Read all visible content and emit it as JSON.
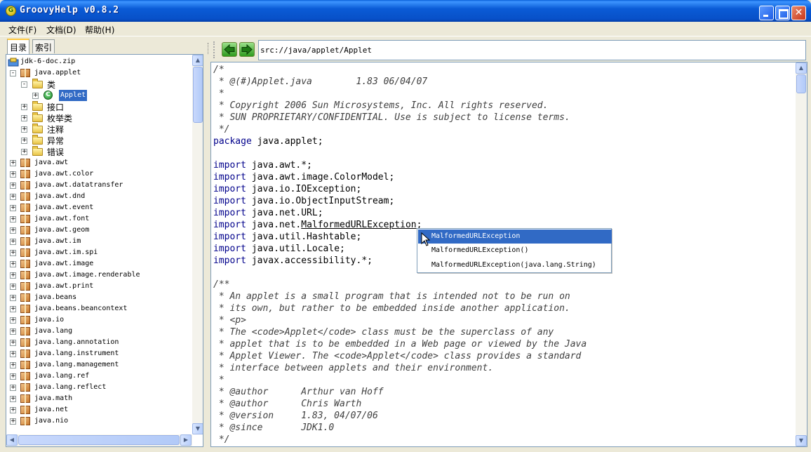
{
  "window": {
    "title": "GroovyHelp v0.8.2",
    "app_icon_glyph": "G",
    "minimize_glyph": "",
    "maximize_glyph": "",
    "close_glyph": "✕"
  },
  "menu": [
    {
      "label": "文件(F)"
    },
    {
      "label": "文档(D)"
    },
    {
      "label": "帮助(H)"
    }
  ],
  "left_tabs": [
    {
      "label": "目录",
      "active": true
    },
    {
      "label": "索引",
      "active": false
    }
  ],
  "tree": {
    "root": "jdk-6-doc.zip",
    "expanded_package": "java.applet",
    "categories": [
      {
        "label": "类",
        "expanded": true
      },
      {
        "label": "接口"
      },
      {
        "label": "枚举类"
      },
      {
        "label": "注释"
      },
      {
        "label": "异常"
      },
      {
        "label": "错误"
      }
    ],
    "selected_class": "Applet",
    "class_icon_glyph": "C",
    "packages": [
      "java.awt",
      "java.awt.color",
      "java.awt.datatransfer",
      "java.awt.dnd",
      "java.awt.event",
      "java.awt.font",
      "java.awt.geom",
      "java.awt.im",
      "java.awt.im.spi",
      "java.awt.image",
      "java.awt.image.renderable",
      "java.awt.print",
      "java.beans",
      "java.beans.beancontext",
      "java.io",
      "java.lang",
      "java.lang.annotation",
      "java.lang.instrument",
      "java.lang.management",
      "java.lang.ref",
      "java.lang.reflect",
      "java.math",
      "java.net",
      "java.nio"
    ]
  },
  "toolbar": {
    "back_icon": "back-arrow-icon",
    "forward_icon": "forward-arrow-icon",
    "address": "src://java/applet/Applet"
  },
  "code_lines": [
    {
      "type": "comment",
      "text": "/*"
    },
    {
      "type": "comment",
      "text": " * @(#)Applet.java        1.83 06/04/07"
    },
    {
      "type": "comment",
      "text": " *"
    },
    {
      "type": "comment",
      "text": " * Copyright 2006 Sun Microsystems, Inc. All rights reserved."
    },
    {
      "type": "comment",
      "text": " * SUN PROPRIETARY/CONFIDENTIAL. Use is subject to license terms."
    },
    {
      "type": "comment",
      "text": " */"
    },
    {
      "type": "code",
      "kw": "package",
      "text": " java.applet;"
    },
    {
      "type": "blank",
      "text": ""
    },
    {
      "type": "code",
      "kw": "import",
      "text": " java.awt.*;"
    },
    {
      "type": "code",
      "kw": "import",
      "text": " java.awt.image.ColorModel;"
    },
    {
      "type": "code",
      "kw": "import",
      "text": " java.io.IOException;"
    },
    {
      "type": "code",
      "kw": "import",
      "text": " java.io.ObjectInputStream;"
    },
    {
      "type": "code",
      "kw": "import",
      "text": " java.net.URL;"
    },
    {
      "type": "link",
      "kw": "import",
      "pre": " java.net.",
      "link": "MalformedURLException",
      "post": ";"
    },
    {
      "type": "code",
      "kw": "import",
      "text": " java.util.Hashtable;"
    },
    {
      "type": "code",
      "kw": "import",
      "text": " java.util.Locale;"
    },
    {
      "type": "code",
      "kw": "import",
      "text": " javax.accessibility.*;"
    },
    {
      "type": "blank",
      "text": ""
    },
    {
      "type": "comment",
      "text": "/**"
    },
    {
      "type": "comment",
      "text": " * An applet is a small program that is intended not to be run on"
    },
    {
      "type": "comment",
      "text": " * its own, but rather to be embedded inside another application."
    },
    {
      "type": "comment",
      "text": " * <p>"
    },
    {
      "type": "comment",
      "text": " * The <code>Applet</code> class must be the superclass of any"
    },
    {
      "type": "comment",
      "text": " * applet that is to be embedded in a Web page or viewed by the Java"
    },
    {
      "type": "comment",
      "text": " * Applet Viewer. The <code>Applet</code> class provides a standard"
    },
    {
      "type": "comment",
      "text": " * interface between applets and their environment."
    },
    {
      "type": "comment",
      "text": " *"
    },
    {
      "type": "comment",
      "text": " * @author      Arthur van Hoff"
    },
    {
      "type": "comment",
      "text": " * @author      Chris Warth"
    },
    {
      "type": "comment",
      "text": " * @version     1.83, 04/07/06"
    },
    {
      "type": "comment",
      "text": " * @since       JDK1.0"
    },
    {
      "type": "comment",
      "text": " */"
    }
  ],
  "completion": {
    "items": [
      {
        "label": "MalformedURLException",
        "selected": true
      },
      {
        "label": "MalformedURLException()"
      },
      {
        "label": "MalformedURLException(java.lang.String)"
      }
    ]
  },
  "scrollbar_glyphs": {
    "up": "▲",
    "down": "▼",
    "left": "◀",
    "right": "▶"
  },
  "colors": {
    "titlebar": "#0A5BD6",
    "selection": "#316AC5",
    "keyword": "#00008B",
    "window_bg": "#ECE9D8"
  }
}
